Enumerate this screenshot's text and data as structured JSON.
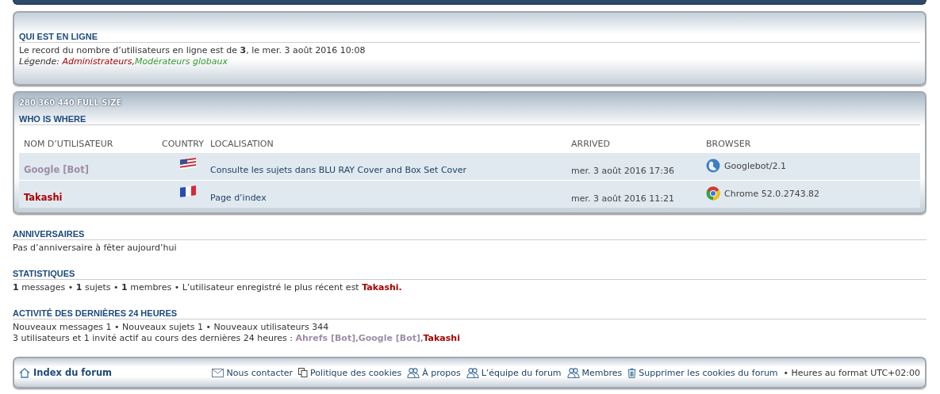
{
  "online": {
    "heading": "QUI EST EN LIGNE",
    "record": "Le record du nombre d’utilisateurs en ligne est de **3**, le mer. 3 août 2016 10:08",
    "legend_label": "Légende:",
    "legend_separator": ",",
    "groups": [
      {
        "name": "Administrateurs",
        "color": "#aa0000"
      },
      {
        "name": "Modérateurs globaux",
        "color": "#339933"
      }
    ]
  },
  "who_is_where": {
    "sizes": "280 360 440 FULL SIZE",
    "heading": "WHO IS WHERE",
    "columns": [
      "NOM D’UTILISATEUR",
      "COUNTRY",
      "LOCALISATION",
      "ARRIVED",
      "BROWSER"
    ],
    "rows": [
      {
        "user": "Google [Bot]",
        "color": "#9e8da7",
        "country": {
          "kind": "us"
        },
        "location": "Consulte les sujets dans BLU RAY Cover and Box Set Cover",
        "arrived": "mer. 3 août 2016 17:36",
        "browser": {
          "kind": "globe",
          "name": "Googlebot/2.1"
        }
      },
      {
        "user": "Takashi",
        "color": "#aa0000",
        "country": {
          "kind": "fr"
        },
        "location": "Page d’index",
        "arrived": "mer. 3 août 2016 11:21",
        "browser": {
          "kind": "chrome",
          "name": "Chrome 52.0.2743.82"
        }
      }
    ]
  },
  "birthdays": {
    "heading": "ANNIVERSAIRES",
    "text": "Pas d’anniversaire à fêter aujourd’hui"
  },
  "statistics": {
    "heading": "STATISTIQUES",
    "text": "**1** messages • **1** sujets • **1** membres • L’utilisateur enregistré le plus récent est",
    "newest_user": {
      "name": "Takashi",
      "color": "#aa0000"
    },
    "end": "."
  },
  "activity": {
    "heading": "ACTIVITÉ DES DERNIÈRES 24 HEURES",
    "line": "Nouveaux messages 1 • Nouveaux sujets 1 • Nouveaux utilisateurs 344",
    "users_text": "3 utilisateurs et 1 invité actif au cours des dernières 24 heures :",
    "separator": ",",
    "users": [
      {
        "name": "Ahrefs [Bot]",
        "color": "#9e8da7"
      },
      {
        "name": "Google [Bot]",
        "color": "#9e8da7"
      },
      {
        "name": "Takashi",
        "color": "#aa0000"
      }
    ]
  },
  "footer": {
    "home": "Index du forum",
    "links": [
      {
        "kind": "mail",
        "label": "Nous contacter"
      },
      {
        "kind": "pages",
        "label": "Politique des cookies"
      },
      {
        "kind": "users",
        "label": "À propos"
      },
      {
        "kind": "users",
        "label": "L’équipe du forum"
      },
      {
        "kind": "users",
        "label": "Membres"
      },
      {
        "kind": "trash",
        "label": "Supprimer les cookies du forum"
      }
    ],
    "timezone": "• Heures au format UTC+02:00"
  }
}
